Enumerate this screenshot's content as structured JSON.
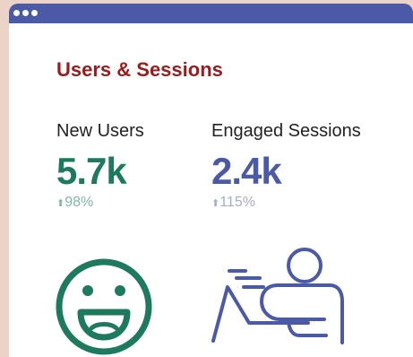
{
  "header": {
    "title": "Users & Sessions"
  },
  "metrics": [
    {
      "label": "New Users",
      "value": "5.7k",
      "change": "98%",
      "trend": "up",
      "color": "#1e7a5e"
    },
    {
      "label": "Engaged Sessions",
      "value": "2.4k",
      "change": "115%",
      "trend": "up",
      "color": "#4b5aa6"
    }
  ],
  "icons": {
    "metric_1": "smiley-face-icon",
    "metric_2": "person-at-laptop-icon"
  }
}
